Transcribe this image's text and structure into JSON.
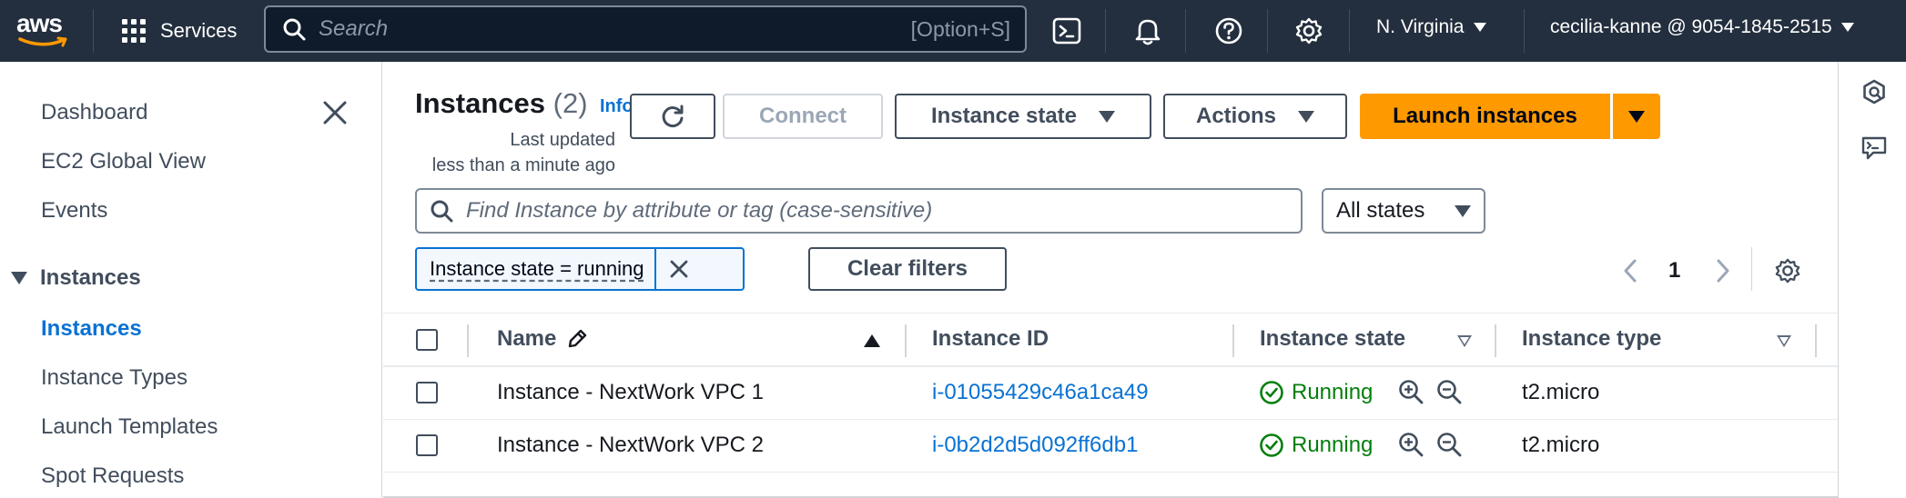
{
  "topbar": {
    "logo_text": "aws",
    "services_label": "Services",
    "search_placeholder": "Search",
    "search_shortcut": "[Option+S]",
    "region": "N. Virginia",
    "account": "cecilia-kanne @ 9054-1845-2515"
  },
  "sidebar": {
    "items": [
      {
        "label": "Dashboard"
      },
      {
        "label": "EC2 Global View"
      },
      {
        "label": "Events"
      }
    ],
    "section": {
      "label": "Instances"
    },
    "section_items": [
      {
        "label": "Instances",
        "active": true
      },
      {
        "label": "Instance Types"
      },
      {
        "label": "Launch Templates"
      },
      {
        "label": "Spot Requests"
      }
    ]
  },
  "main": {
    "title": "Instances",
    "count": "(2)",
    "info": "Info",
    "last_updated_line1": "Last updated",
    "last_updated_line2": "less than a minute ago",
    "connect": "Connect",
    "instance_state": "Instance state",
    "actions": "Actions",
    "launch": "Launch instances",
    "filter_placeholder": "Find Instance by attribute or tag (case-sensitive)",
    "states_select": "All states",
    "token": "Instance state = running",
    "clear_filters": "Clear filters",
    "page": "1"
  },
  "table": {
    "columns": [
      "Name",
      "Instance ID",
      "Instance state",
      "Instance type"
    ],
    "rows": [
      {
        "name": "Instance - NextWork VPC 1",
        "id": "i-01055429c46a1ca49",
        "state": "Running",
        "type": "t2.micro"
      },
      {
        "name": "Instance - NextWork VPC 2",
        "id": "i-0b2d2d5d092ff6db1",
        "state": "Running",
        "type": "t2.micro"
      }
    ]
  },
  "colors": {
    "topbar": "#232f3e",
    "link": "#0972d3",
    "primary": "#ff9900",
    "running": "#037f0c"
  }
}
